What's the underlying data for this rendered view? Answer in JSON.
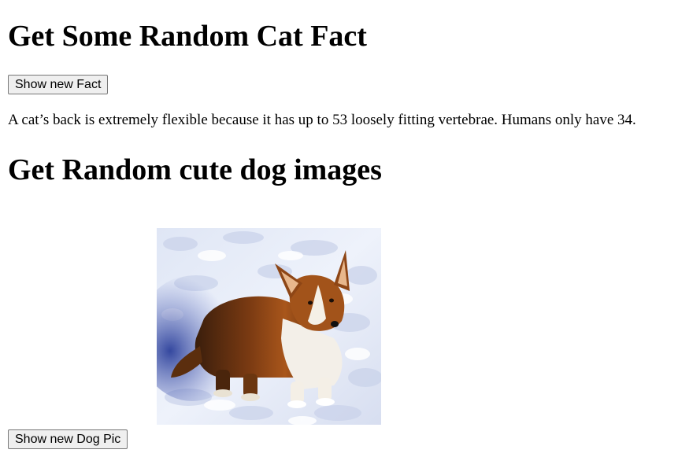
{
  "cat_section": {
    "heading": "Get Some Random Cat Fact",
    "button_label": "Show new Fact",
    "fact": "A cat’s back is extremely flexible because it has up to 53 loosely fitting vertebrae. Humans only have 34."
  },
  "dog_section": {
    "heading": "Get Random cute dog images",
    "image_subject": "corgi-in-snow",
    "button_label": "Show new Dog Pic"
  },
  "colors": {
    "button_bg": "#efefef",
    "button_border": "#767676",
    "text": "#000000"
  }
}
